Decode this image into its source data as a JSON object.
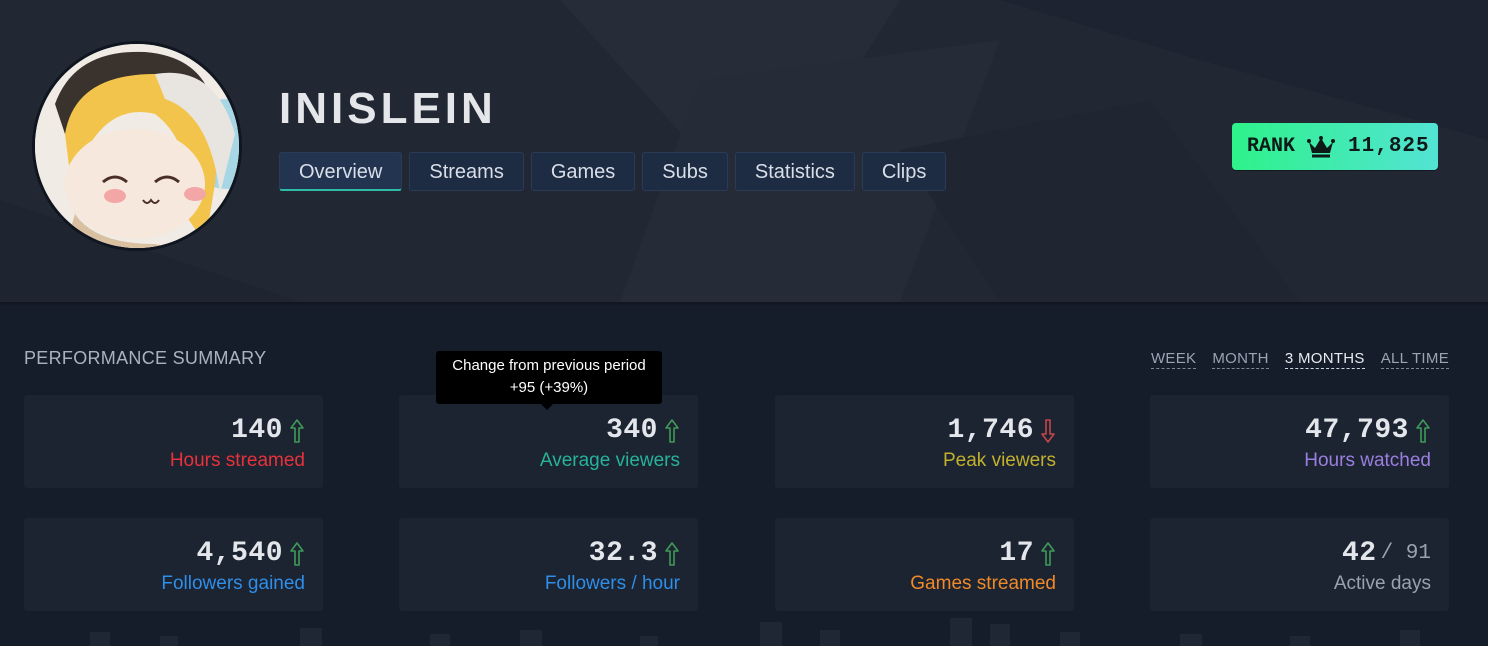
{
  "channel": {
    "name": "INISLEIN"
  },
  "tabs": [
    {
      "label": "Overview",
      "active": true
    },
    {
      "label": "Streams"
    },
    {
      "label": "Games"
    },
    {
      "label": "Subs"
    },
    {
      "label": "Statistics"
    },
    {
      "label": "Clips"
    }
  ],
  "rank": {
    "label": "RANK",
    "icon": "crown-icon",
    "value": "11,825"
  },
  "performance": {
    "title": "PERFORMANCE SUMMARY",
    "periods": [
      "WEEK",
      "MONTH",
      "3 MONTHS",
      "ALL TIME"
    ],
    "active_period": "3 MONTHS",
    "stats": [
      {
        "value": "140",
        "label": "Hours streamed",
        "trend": "up",
        "label_color": "#e8323b"
      },
      {
        "value": "340",
        "label": "Average viewers",
        "trend": "up",
        "label_color": "#26b399"
      },
      {
        "value": "1,746",
        "label": "Peak viewers",
        "trend": "down",
        "label_color": "#c2b12c"
      },
      {
        "value": "47,793",
        "label": "Hours watched",
        "trend": "up",
        "label_color": "#9b7fe0"
      },
      {
        "value": "4,540",
        "label": "Followers gained",
        "trend": "up",
        "label_color": "#2e8ee8"
      },
      {
        "value": "32.3",
        "label": "Followers / hour",
        "trend": "up",
        "label_color": "#2e8ee8"
      },
      {
        "value": "17",
        "label": "Games streamed",
        "trend": "up",
        "label_color": "#ef8a27"
      },
      {
        "value": "42",
        "total": "/ 91",
        "label": "Active days",
        "trend": "none",
        "label_color": "#9aa2ae"
      }
    ]
  },
  "tooltip": {
    "title": "Change from previous period",
    "detail": "+95 (+39%)"
  },
  "colors": {
    "trend_up": "#3f9a58",
    "trend_down": "#c4454a",
    "rank_start": "#2ef28a",
    "rank_end": "#53e3d4"
  }
}
